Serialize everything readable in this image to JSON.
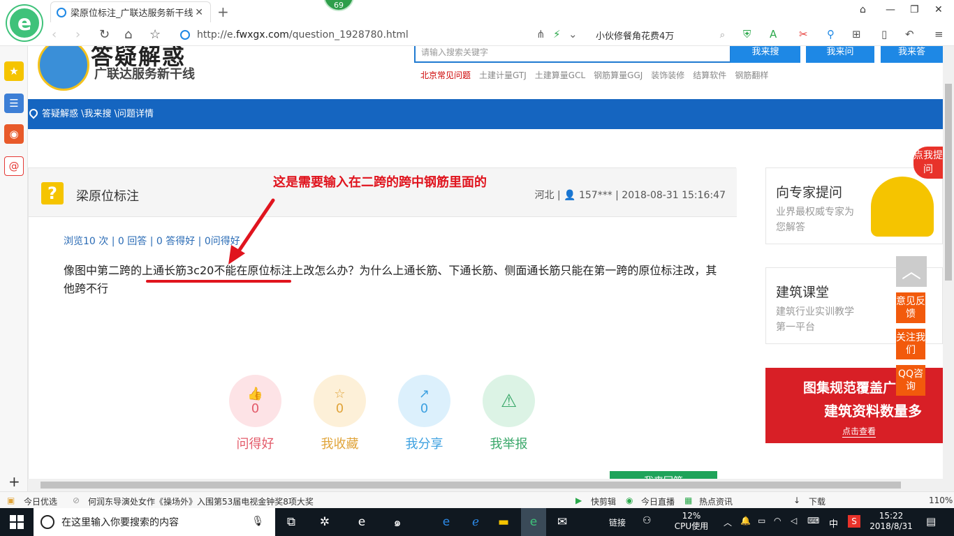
{
  "browser": {
    "tab_title": "梁原位标注_广联达服务新干线",
    "tab_close": "✕",
    "new_tab": "+",
    "badge": "69",
    "url_prefix": "http://e.",
    "url_host": "fwxgx.com",
    "url_path": "/question_1928780.html",
    "search_text": "小伙修餐角花费4万",
    "logo_letter": "e"
  },
  "site": {
    "brand_title": "答疑解惑",
    "brand_subtitle": "广联达服务新干线",
    "search_placeholder": "请输入搜索关键字",
    "btn_search": "我来搜",
    "btn_ask": "我来问",
    "btn_answer": "我来答",
    "categories": [
      "北京常见问题",
      "土建计量GTJ",
      "土建算量GCL",
      "钢筋算量GGJ",
      "装饰装修",
      "结算软件",
      "钢筋翻样"
    ],
    "breadcrumb": "答疑解惑 \\我来搜 \\问题详情"
  },
  "question": {
    "icon": "?",
    "title": "梁原位标注",
    "meta": "河北 | 👤 157*** | 2018-08-31 15:16:47",
    "annotation": "这是需要输入在二跨的跨中钢筋里面的",
    "stats": "浏览10 次 | 0 回答 | 0 答得好 | 0问得好",
    "body": "像图中第二跨的上通长筋3c20不能在原位标注上改怎么办？为什么上通长筋、下通长筋、侧面通长筋只能在第一跨的原位标注改，其他跨不行",
    "answer_button": "我来回答"
  },
  "actions": [
    {
      "icon": "👍",
      "count": "0",
      "label": "问得好",
      "color": "#e35b6a",
      "bg": "#fde3e6"
    },
    {
      "icon": "☆",
      "count": "0",
      "label": "我收藏",
      "color": "#e0a43a",
      "bg": "#fdf0d8"
    },
    {
      "icon": "↗",
      "count": "0",
      "label": "我分享",
      "color": "#3ca0e0",
      "bg": "#dcf0fc"
    },
    {
      "icon": "⚠",
      "count": "",
      "label": "我举报",
      "color": "#3aa86a",
      "bg": "#dcf3e5"
    }
  ],
  "sidebar": {
    "expert_title": "向专家提问",
    "expert_sub": "业界最权威专家为您解答",
    "class_title": "建筑课堂",
    "class_sub": "建筑行业实训教学第一平台",
    "banner_line1": "图集规范覆盖广",
    "banner_line2": "建筑资料数量多",
    "banner_line3": "点击查看",
    "float_feedback": "意见反馈",
    "float_follow": "关注我们",
    "float_qq": "QQ咨询",
    "corner_text": "点我提问"
  },
  "statusbar": {
    "today": "今日优选",
    "news": "何润东导演处女作《操场外》入围第53届电视金钟奖8项大奖",
    "clip": "快剪辑",
    "live": "今日直播",
    "hot": "热点资讯",
    "download": "下载",
    "zoom": "110%"
  },
  "taskbar": {
    "search_placeholder": "在这里输入你要搜索的内容",
    "links": "链接",
    "cpu_pct": "12%",
    "cpu_label": "CPU使用",
    "ime": "中",
    "time": "15:22",
    "date": "2018/8/31"
  }
}
